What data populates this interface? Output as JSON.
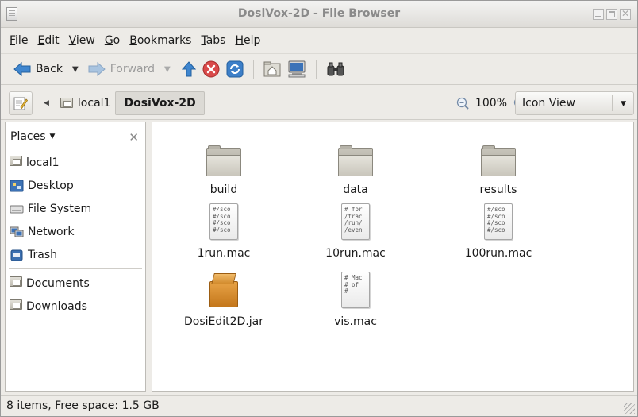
{
  "window": {
    "title": "DosiVox-2D - File Browser"
  },
  "menubar": {
    "items": [
      {
        "key": "F",
        "rest": "ile"
      },
      {
        "key": "E",
        "rest": "dit"
      },
      {
        "key": "V",
        "rest": "iew"
      },
      {
        "key": "G",
        "rest": "o"
      },
      {
        "key": "B",
        "rest": "ookmarks"
      },
      {
        "key": "T",
        "rest": "abs"
      },
      {
        "key": "H",
        "rest": "elp"
      }
    ]
  },
  "toolbar": {
    "back_label": "Back",
    "forward_label": "Forward"
  },
  "location": {
    "crumb_parent": "local1",
    "crumb_current": "DosiVox-2D",
    "zoom": "100%",
    "view_mode": "Icon View"
  },
  "sidebar": {
    "header": "Places",
    "items": [
      {
        "label": "local1",
        "icon": "drive-icon"
      },
      {
        "label": "Desktop",
        "icon": "desktop-icon"
      },
      {
        "label": "File System",
        "icon": "filesystem-icon"
      },
      {
        "label": "Network",
        "icon": "network-icon"
      },
      {
        "label": "Trash",
        "icon": "trash-icon"
      }
    ],
    "bookmarks": [
      {
        "label": "Documents",
        "icon": "folder-icon"
      },
      {
        "label": "Downloads",
        "icon": "folder-icon"
      }
    ]
  },
  "files": [
    {
      "name": "build",
      "type": "folder"
    },
    {
      "name": "data",
      "type": "folder"
    },
    {
      "name": "results",
      "type": "folder"
    },
    {
      "name": "1run.mac",
      "type": "text",
      "preview": "#/sco\n#/sco\n#/sco\n#/sco"
    },
    {
      "name": "10run.mac",
      "type": "text",
      "preview": "# for\n/trac\n/run/\n/even"
    },
    {
      "name": "100run.mac",
      "type": "text",
      "preview": "#/sco\n#/sco\n#/sco\n#/sco"
    },
    {
      "name": "DosiEdit2D.jar",
      "type": "jar"
    },
    {
      "name": "vis.mac",
      "type": "text",
      "preview": "# Mac\n# of\n#"
    }
  ],
  "status": {
    "text": "8 items, Free space: 1.5 GB"
  }
}
